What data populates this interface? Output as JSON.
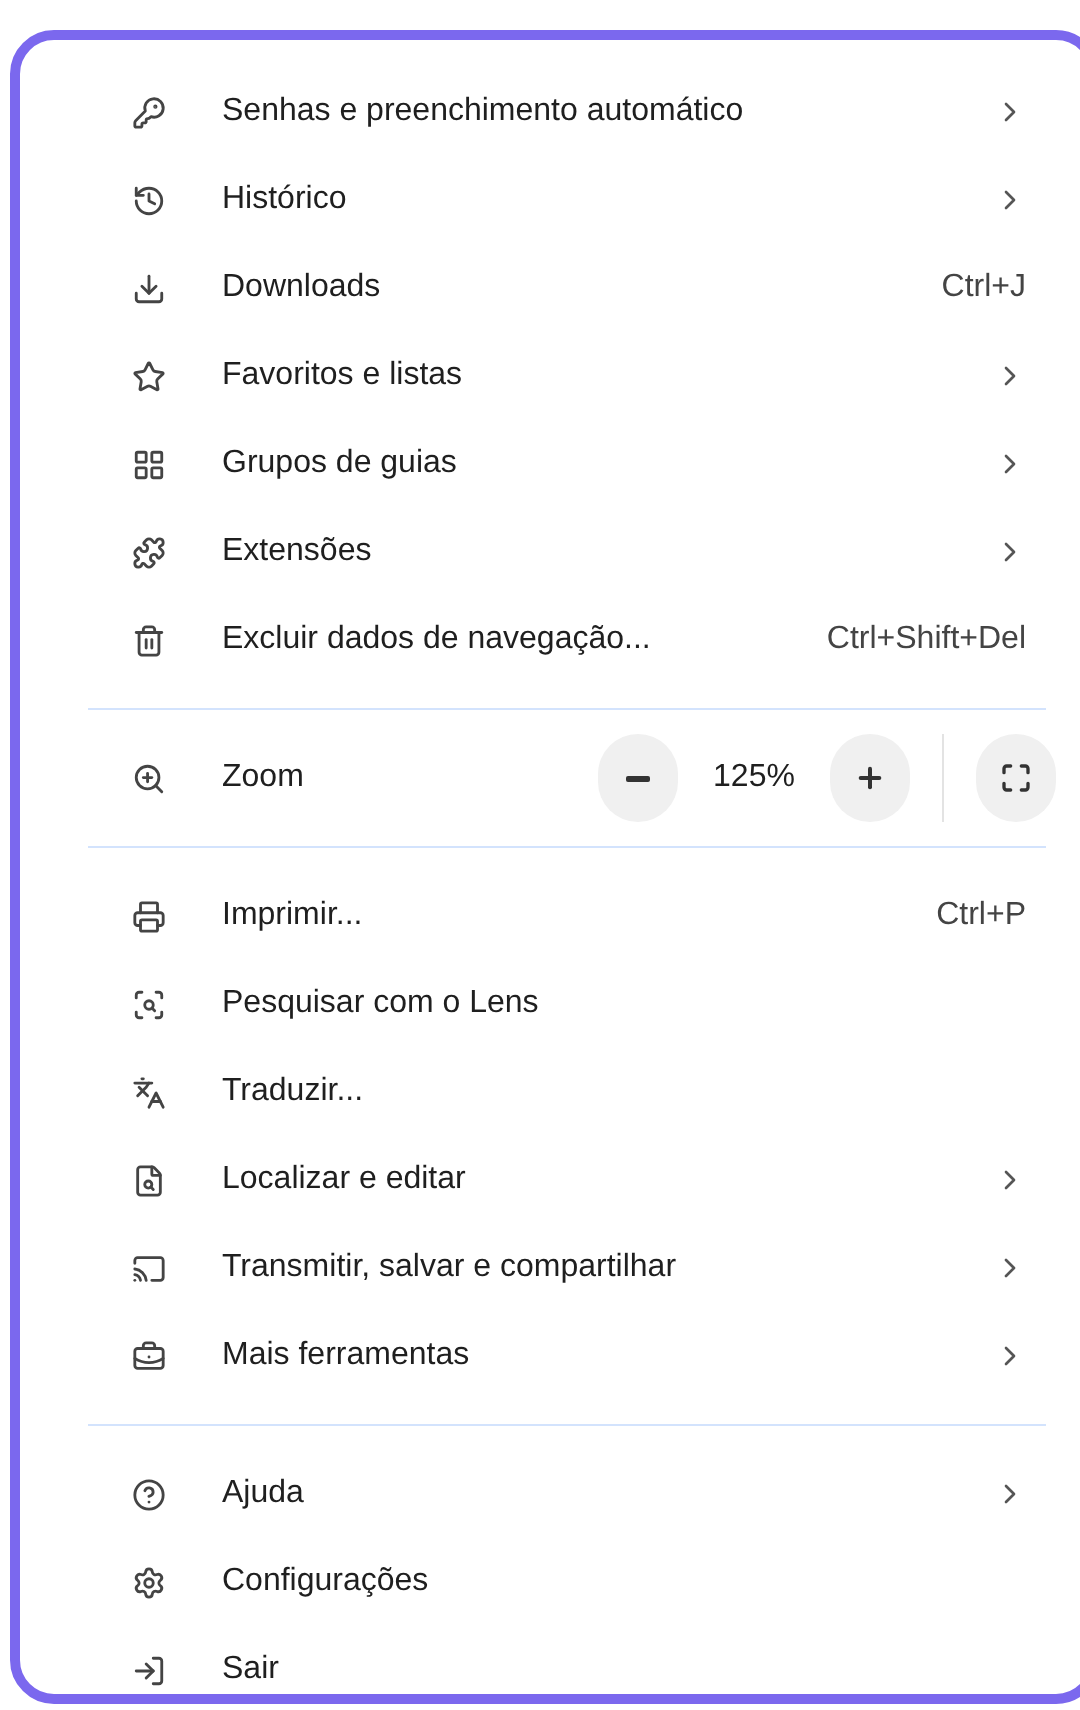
{
  "menu": [
    {
      "kind": "items",
      "items": [
        {
          "label": "Senhas e preenchimento automático",
          "kind": "submenu"
        },
        {
          "label": "Histórico",
          "kind": "submenu"
        },
        {
          "label": "Downloads",
          "kind": "shortcut",
          "shortcut": "Ctrl+J"
        },
        {
          "label": "Favoritos e listas",
          "kind": "submenu"
        },
        {
          "label": "Grupos de guias",
          "kind": "submenu"
        },
        {
          "label": "Extensões",
          "kind": "submenu"
        },
        {
          "label": "Excluir dados de navegação...",
          "kind": "shortcut",
          "shortcut": "Ctrl+Shift+Del"
        }
      ]
    },
    {
      "kind": "zoom",
      "label": "Zoom",
      "value": "125%"
    },
    {
      "kind": "items",
      "items": [
        {
          "label": "Imprimir...",
          "kind": "shortcut",
          "shortcut": "Ctrl+P"
        },
        {
          "label": "Pesquisar com o Lens",
          "kind": "plain"
        },
        {
          "label": "Traduzir...",
          "kind": "plain"
        },
        {
          "label": "Localizar e editar",
          "kind": "submenu"
        },
        {
          "label": "Transmitir, salvar e compartilhar",
          "kind": "submenu"
        },
        {
          "label": "Mais ferramentas",
          "kind": "submenu"
        }
      ]
    },
    {
      "kind": "items",
      "items": [
        {
          "label": "Ajuda",
          "kind": "submenu"
        },
        {
          "label": "Configurações",
          "kind": "plain"
        },
        {
          "label": "Sair",
          "kind": "plain"
        }
      ]
    }
  ]
}
